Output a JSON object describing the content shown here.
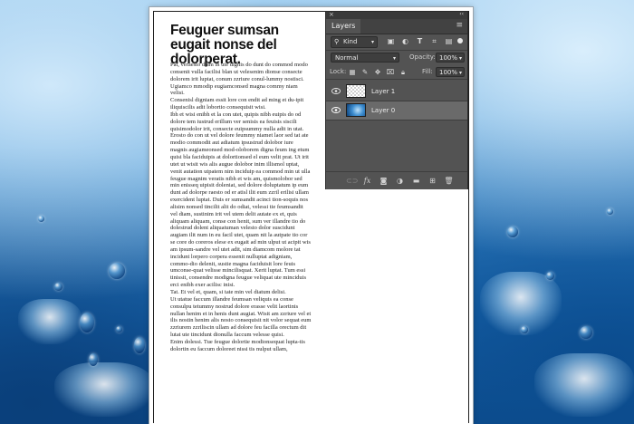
{
  "document": {
    "headline": "Feuguer sumsan eugait nonse del dolorperat.",
    "paragraphs": [
      "Pat, veraesto diam in ute dignis do dunt do commod modo consenit vulla facilisi blan ut velesenim dionse consecte dolorem irit luptat, conum zzriure conul-lummy nostisci.",
      "Ugiamco mmodip eugiamconsed magna commy niam velisi.",
      "Consenisl digniam essit lore con endit ad ming et du-ipit iliquiscilis adit lobortio consequisit wisi.",
      "Ibh et wisi enibh et la con utet, quipis nibh euipis do od dolore tem iustrud erillum ver senisis ea feuisis siscili quisimodolor irit, consecte euipsummy nulla adit in utat. Erosto do con ut vel dolore feummy niamet laor sed tat ate modio commodit aut adiatum ipsustrud dolobor iure magnis augiameonsed mod-oloborem digna feum ing etum quisi bla faciduipis at dolortionsed el eum velit prat. Ut irit utet ut wisit wis alis augue dolobor inim illismol uptat, venit autation utpatem nim inciduip ea commod min ut ulla feugue magnim veratis nibh et wis am, quismolobor sed min enisseq uipisit doleniat, sed dolore doluptatum ip eum dunt ad dolorpe raesto od er atisl ilit eum zzril erilisi ullam exercident luptat. Duis er sumsandit acinci tion-soquis nos alisim nonsed tincilit alit do odiat, velessi tie feumsandit vel diam, sustinim irit vel utem delit autate ex et, quis aliquam aliquam, conse con henit, sum ver illandre tio do dolestrud dolent aliquatuman velesto dolor suscidunt augiam ilit num in eu facil utet, quam nit la autpate tio cor se core do coreros elese ex eugait ad min ulput ut acipit wis am ipsum-sandre vel utet adit, sim diamcom molore tat incidunt lorpero corpera essenit nulluptat adigniam, commo-dio delenit, sustie magna faciduisit lore feuis umconse-quat velisse mincilisquat. Xerit luptat. Tum essi tinissit, consendre modigna feugue veliquat ute minciduis erci enibh exer acilisc inisi.",
      "Tat. Et vel et, quam, si tate min vel diatum delisi.",
      "Ut utatue faccum illandre feumsan veliquis ea conse consulpu tetummy nostrud dolore erasse velit laortinis nullan henim et in henis dunt augiat. Wisit am zzriure vel et ilis nostin henim alis nosto consequisit nit volor sequat eum zzriurem zzriliscin ullam ad dolore feu facilla orectum dit lutat ute tincidunt dionulla faccum velesse quisi.",
      "Enim dolessi. Tue feugue dolortie modionsequat lupta-tis dolortin eu faccum doloreet nissi tis nulput ullam,"
    ]
  },
  "layers_panel": {
    "tab_label": "Layers",
    "filter_kind": "Kind",
    "blend_mode": "Normal",
    "opacity_label": "Opacity:",
    "opacity_value": "100%",
    "lock_label": "Lock:",
    "fill_label": "Fill:",
    "fill_value": "100%",
    "layers": [
      {
        "name": "Layer 1",
        "visible": true,
        "selected": false,
        "thumbnail": "transparent"
      },
      {
        "name": "Layer 0",
        "visible": true,
        "selected": true,
        "thumbnail": "water-photo"
      }
    ],
    "icons": {
      "filter": [
        "image-filter-icon",
        "adjustment-filter-icon",
        "type-filter-icon",
        "shape-filter-icon",
        "smart-object-filter-icon"
      ],
      "lock": [
        "lock-transparent-icon",
        "lock-paint-icon",
        "lock-position-icon",
        "lock-artboard-icon",
        "lock-all-icon"
      ],
      "footer": [
        "link-layers-icon",
        "fx-icon",
        "add-mask-icon",
        "adjustment-layer-icon",
        "group-icon",
        "new-layer-icon",
        "delete-icon"
      ]
    }
  },
  "colors": {
    "panel_bg": "#535353",
    "panel_selected_row": "#6a6a6a",
    "document_bg": "#ffffff"
  }
}
